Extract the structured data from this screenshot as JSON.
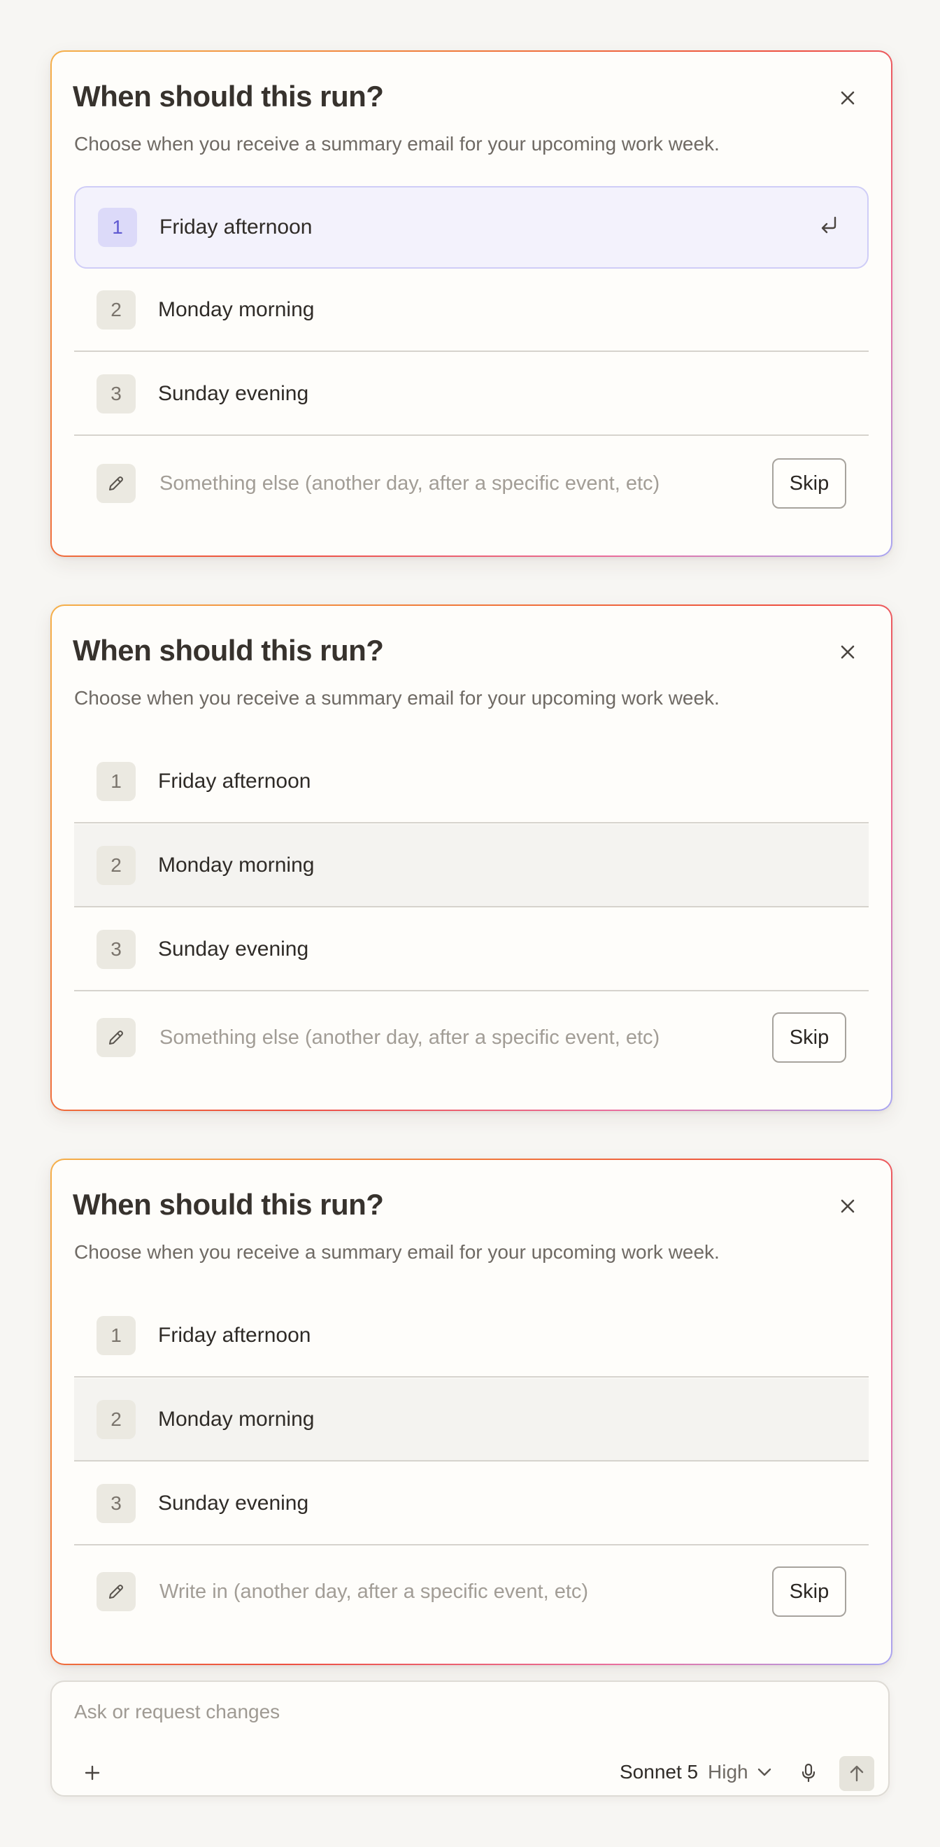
{
  "colors": {
    "background": "#f7f6f3",
    "card_background": "#fefdfa",
    "accent_selected": "#5f59d1",
    "selected_fill": "#f3f2fc",
    "border_gradient": [
      "#f5b04a",
      "#ee5040",
      "#a9a6f2"
    ]
  },
  "cards": [
    {
      "title": "When should this run?",
      "subtitle": "Choose when you receive a summary email for your upcoming work week.",
      "close_icon": "close-icon",
      "selected_option": 1,
      "hovered_option": null,
      "options": [
        {
          "number": "1",
          "label": "Friday afternoon"
        },
        {
          "number": "2",
          "label": "Monday morning"
        },
        {
          "number": "3",
          "label": "Sunday evening"
        }
      ],
      "enter_icon": "enter-return-icon",
      "write_in": {
        "icon": "pencil-icon",
        "placeholder": "Something else (another day, after a specific event, etc)",
        "value": ""
      },
      "skip_label": "Skip"
    },
    {
      "title": "When should this run?",
      "subtitle": "Choose when you receive a summary email for your upcoming work week.",
      "close_icon": "close-icon",
      "selected_option": null,
      "hovered_option": 2,
      "options": [
        {
          "number": "1",
          "label": "Friday afternoon"
        },
        {
          "number": "2",
          "label": "Monday morning"
        },
        {
          "number": "3",
          "label": "Sunday evening"
        }
      ],
      "write_in": {
        "icon": "pencil-icon",
        "placeholder": "Something else (another day, after a specific event, etc)",
        "value": ""
      },
      "skip_label": "Skip"
    },
    {
      "title": "When should this run?",
      "subtitle": "Choose when you receive a summary email for your upcoming work week.",
      "close_icon": "close-icon",
      "selected_option": null,
      "hovered_option": 2,
      "options": [
        {
          "number": "1",
          "label": "Friday afternoon"
        },
        {
          "number": "2",
          "label": "Monday morning"
        },
        {
          "number": "3",
          "label": "Sunday evening"
        }
      ],
      "write_in": {
        "icon": "pencil-icon",
        "placeholder": "Write in (another day, after a specific event, etc)",
        "value": ""
      },
      "skip_label": "Skip"
    }
  ],
  "composer": {
    "placeholder": "Ask or request changes",
    "value": "",
    "add_icon": "plus-icon",
    "model_label": "Sonnet 5",
    "effort_label": "High",
    "effort_icon": "chevron-down-icon",
    "mic_icon": "microphone-icon",
    "send_icon": "arrow-up-icon"
  }
}
